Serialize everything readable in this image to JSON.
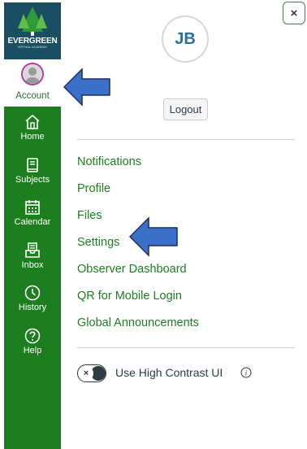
{
  "logo": {
    "name": "EVERGREEN",
    "subtitle": "VIRTUAL ACADEMY"
  },
  "nav": {
    "account_label": "Account",
    "items": [
      {
        "label": "Home",
        "icon": "home-icon"
      },
      {
        "label": "Subjects",
        "icon": "book-icon"
      },
      {
        "label": "Calendar",
        "icon": "calendar-icon"
      },
      {
        "label": "Inbox",
        "icon": "inbox-icon"
      },
      {
        "label": "History",
        "icon": "clock-icon"
      },
      {
        "label": "Help",
        "icon": "help-icon"
      }
    ]
  },
  "tray": {
    "close_label": "×",
    "avatar_initials": "JB",
    "logout_label": "Logout",
    "links": [
      "Notifications",
      "Profile",
      "Files",
      "Settings",
      "Observer Dashboard",
      "QR for Mobile Login",
      "Global Announcements"
    ],
    "high_contrast_label": "Use High Contrast UI",
    "toggle_state": "off",
    "toggle_glyph": "×"
  },
  "colors": {
    "nav_green": "#1d7e1f",
    "logo_bg": "#1a4f63",
    "link_green": "#1d7e1f",
    "arrow_blue": "#3c6fc8"
  }
}
